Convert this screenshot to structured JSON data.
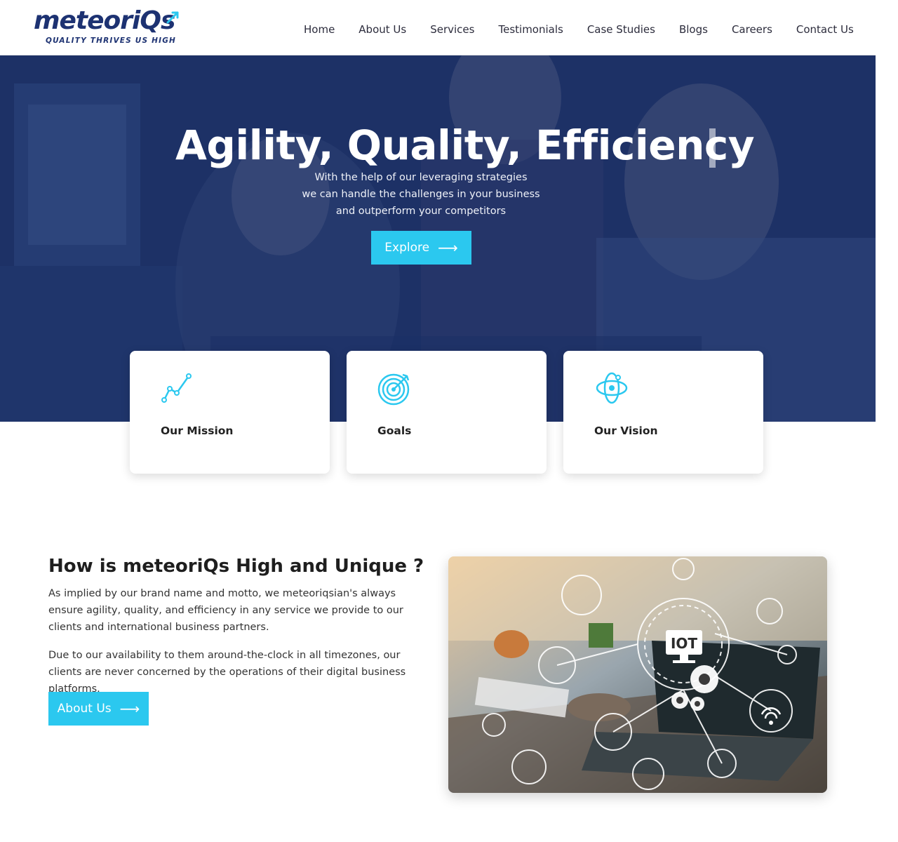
{
  "brand": {
    "name": "meteoriQs",
    "tagline": "QUALITY THRIVES US HIGH"
  },
  "nav": {
    "items": [
      "Home",
      "About Us",
      "Services",
      "Testimonials",
      "Case Studies",
      "Blogs",
      "Careers",
      "Contact Us"
    ]
  },
  "hero": {
    "title": "Agility, Quality, Efficiency",
    "subtitle_lines": [
      "With the help of our leveraging strategies",
      "we can handle the challenges in your business",
      "and outperform your competitors"
    ],
    "button_label": "Explore"
  },
  "cards": [
    {
      "title": "Our Mission",
      "icon": "chart-line-icon"
    },
    {
      "title": "Goals",
      "icon": "target-icon"
    },
    {
      "title": "Our Vision",
      "icon": "orbit-icon"
    }
  ],
  "about": {
    "heading": "How is meteoriQs High and Unique ?",
    "paragraphs": [
      "As implied by our brand name and motto, we meteoriqsian's always ensure agility, quality, and efficiency in any service we provide to our clients and international business partners.",
      "Due to our availability to them around-the-clock in all timezones, our clients are never concerned by the operations of their digital business platforms."
    ],
    "button_label": "About Us",
    "image_label": "IOT"
  },
  "colors": {
    "brand_navy": "#1d3272",
    "accent_cyan": "#2bc8ef",
    "hero_overlay": "#1c2f63"
  }
}
